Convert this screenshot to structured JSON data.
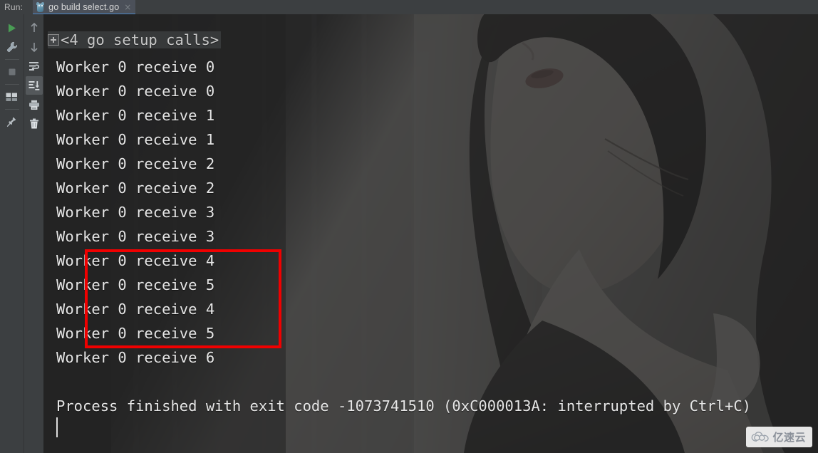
{
  "window": {
    "run_label": "Run:",
    "tab": {
      "title": "go build select.go",
      "icon": "go-gopher-icon",
      "close": "×"
    }
  },
  "toolbar_primary": [
    {
      "name": "rerun-button",
      "icon": "play-icon",
      "tooltip": "Rerun"
    },
    {
      "name": "settings-button",
      "icon": "wrench-icon",
      "tooltip": "Settings"
    },
    {
      "name": "stop-button",
      "icon": "stop-icon",
      "tooltip": "Stop"
    },
    {
      "name": "layout-button",
      "icon": "grid-icon",
      "tooltip": "Layout"
    },
    {
      "name": "pin-tab-button",
      "icon": "pin-icon",
      "tooltip": "Pin Tab"
    }
  ],
  "toolbar_secondary": [
    {
      "name": "prev-occurrence-button",
      "icon": "arrow-up-icon",
      "tooltip": "Up the Stack Trace",
      "active": false
    },
    {
      "name": "next-occurrence-button",
      "icon": "arrow-down-icon",
      "tooltip": "Down the Stack Trace",
      "active": false
    },
    {
      "name": "soft-wrap-button",
      "icon": "soft-wrap-icon",
      "tooltip": "Soft-Wrap",
      "active": false
    },
    {
      "name": "scroll-to-end-button",
      "icon": "scroll-to-end-icon",
      "tooltip": "Scroll to the end",
      "active": true
    },
    {
      "name": "print-button",
      "icon": "printer-icon",
      "tooltip": "Print",
      "active": false
    },
    {
      "name": "clear-all-button",
      "icon": "trash-icon",
      "tooltip": "Clear All",
      "active": false
    }
  ],
  "console": {
    "fold_line": {
      "marker": "expand-fold-icon",
      "text": "<4 go setup calls>"
    },
    "lines": [
      "Worker 0 receive 0",
      "Worker 0 receive 0",
      "Worker 0 receive 1",
      "Worker 0 receive 1",
      "Worker 0 receive 2",
      "Worker 0 receive 2",
      "Worker 0 receive 3",
      "Worker 0 receive 3",
      "Worker 0 receive 4",
      "Worker 0 receive 5",
      "Worker 0 receive 4",
      "Worker 0 receive 5",
      "Worker 0 receive 6"
    ],
    "exit_line": "Process finished with exit code -1073741510 (0xC000013A: interrupted by Ctrl+C)",
    "highlight": {
      "name": "red-annotation-box",
      "color": "#f00000",
      "highlighted_lines": [
        "Worker 0 receive 4",
        "Worker 0 receive 5",
        "Worker 0 receive 4",
        "Worker 0 receive 5"
      ]
    }
  },
  "watermark": {
    "icon": "cloud-icon",
    "text": "亿速云"
  },
  "colors": {
    "console_background": "#2b2b2b",
    "chrome_background": "#3c3f41",
    "tab_active": "#4b5059",
    "tab_underline": "#4a88c7",
    "text": "#e6e6e6",
    "accent_red": "#f00000",
    "run_green": "#499c54"
  }
}
